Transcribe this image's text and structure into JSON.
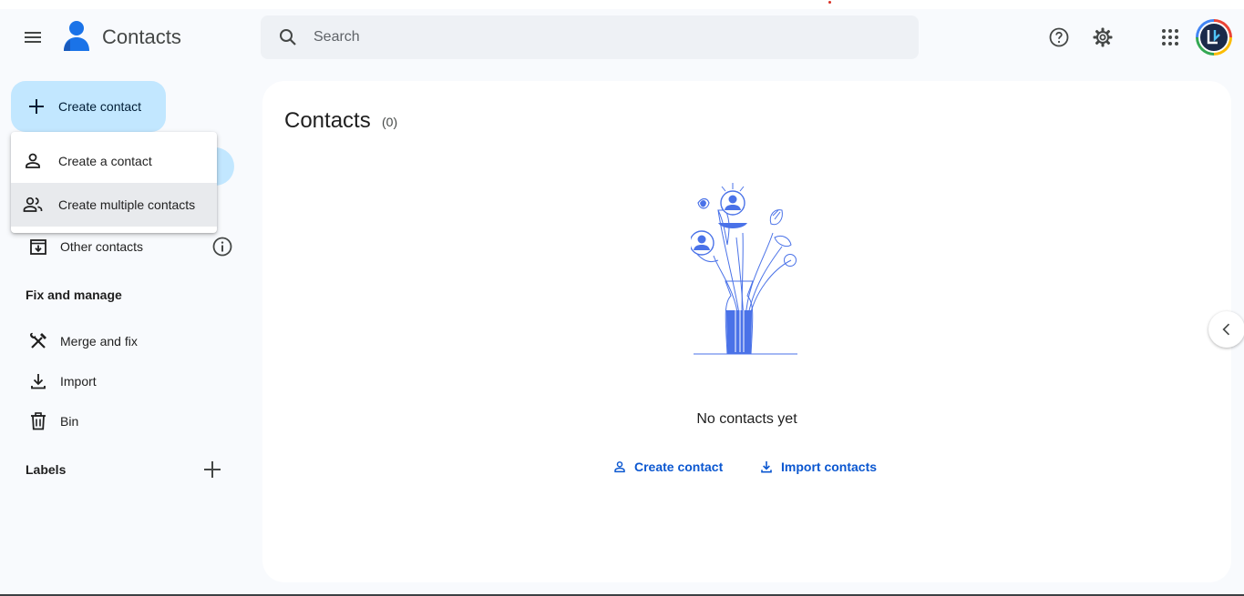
{
  "header": {
    "app_title": "Contacts",
    "search_placeholder": "Search",
    "menu_icon": "hamburger-menu-icon",
    "help_icon": "help-circle-icon",
    "settings_icon": "gear-icon",
    "apps_icon": "apps-grid-icon"
  },
  "sidebar": {
    "create_button_label": "Create contact",
    "create_menu": {
      "items": [
        {
          "label": "Create a contact",
          "icon": "person-icon"
        },
        {
          "label": "Create multiple contacts",
          "icon": "people-icon"
        }
      ]
    },
    "other_contacts_label": "Other contacts",
    "fix_manage_title": "Fix and manage",
    "fix_items": [
      {
        "label": "Merge and fix",
        "icon": "merge-fix-tools-icon"
      },
      {
        "label": "Import",
        "icon": "download-icon"
      },
      {
        "label": "Bin",
        "icon": "trash-icon"
      }
    ],
    "labels_title": "Labels"
  },
  "main": {
    "title": "Contacts",
    "count": "(0)",
    "empty_message": "No contacts yet",
    "create_contact_link": "Create contact",
    "import_contacts_link": "Import contacts"
  },
  "colors": {
    "accent": "#0b57d0",
    "create_button_bg": "#c2e7ff",
    "illustration_blue": "#4a72e8",
    "page_bg": "#f8fafd"
  }
}
